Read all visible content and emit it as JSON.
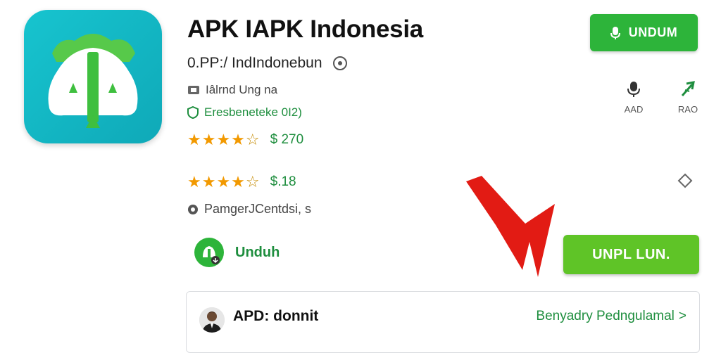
{
  "app": {
    "title": "APK IAPK Indonesia",
    "subtitle": "0.PP:/ IndIndonebun",
    "meta_line": "Iâlrnd Ung na",
    "editor_line": "Eresbeneteke 0I2)",
    "rating_a": {
      "stars": 4,
      "price_text": "$ 270"
    },
    "rating_b": {
      "stars": 4,
      "price_text": "$.18"
    },
    "extra_line": "PamgerJCentdsi, s"
  },
  "actions": {
    "download_button": "UNDUM",
    "side_left_label": "AAD",
    "side_right_label": "RAO",
    "unduh_label": "Unduh",
    "big_button": "UNPL LUN."
  },
  "developer": {
    "name": "APD: donnit",
    "link": "Benyadry Pedngulamal",
    "link_chevron": ">"
  },
  "icons": {
    "app": "app-logo-icon",
    "circle": "settings-circle-icon",
    "ticket": "ticket-icon",
    "shield": "shield-icon",
    "mic": "mic-icon",
    "arrow": "share-arrow-icon",
    "diamond": "diamond-icon",
    "badge": "unduh-badge-icon",
    "pointer": "red-arrow-annotation"
  },
  "colors": {
    "brand_green": "#2db43a",
    "light_green": "#5fc427",
    "teal": "#17c4cf",
    "star": "#f29900",
    "annotation_red": "#e21b14"
  }
}
